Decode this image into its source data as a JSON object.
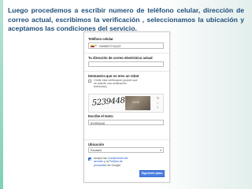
{
  "caption": "Luego procedemos a escribir numero de teléfono celular, dirección de correo actual, escribimos la verificación , seleccionamos la ubicación y aceptamos  las condiciones del servicio.",
  "form": {
    "phone_label": "Teléfono celular",
    "phone_value": "+593997711122",
    "email_label": "Tu dirección de correo electrónico actual",
    "robot_label": "Demuestra que no eres un robot",
    "skip_verification": "Omitir esta verificación (puede que se solicite una verificación telefónica).",
    "captcha_word": "5239448",
    "captcha_house_number": "3448",
    "type_text_label": "Escribe el texto:",
    "type_text_value": "52393448",
    "location_label": "Ubicación",
    "location_value": "Ecuador",
    "accept_prefix": "Acepto las ",
    "accept_link_terms": "Condiciones del servicio",
    "accept_middle": " y la ",
    "accept_link_privacy": "Política de privacidad",
    "accept_suffix": " de Google.",
    "next_button": "Siguiente paso"
  },
  "colors": {
    "caption_text": "#1f4e79",
    "accent": "#7fcfb7",
    "button": "#4a7ee0",
    "link": "#1a55cc"
  },
  "icons": {
    "refresh": "refresh-icon",
    "audio": "audio-icon",
    "help": "help-icon",
    "flag": "flag-icon",
    "dropdown": "chevron-down-icon"
  }
}
